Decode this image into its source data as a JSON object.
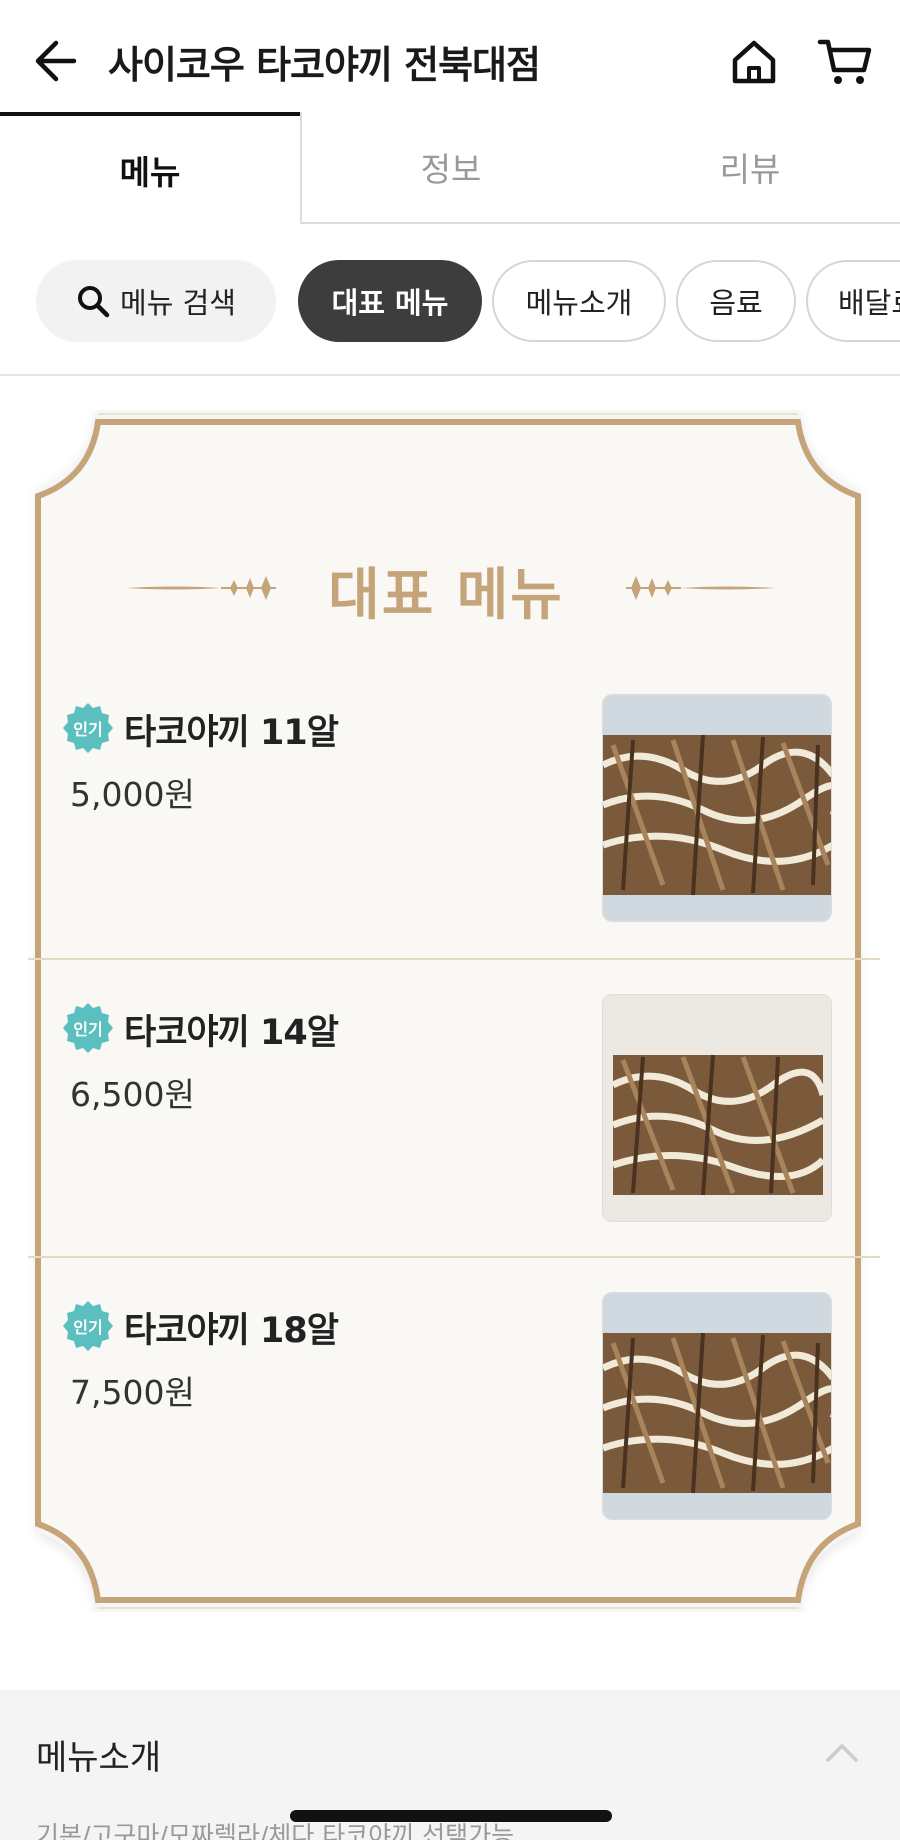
{
  "header": {
    "title": "사이코우 타코야끼 전북대점",
    "back_icon": "back-arrow-icon",
    "home_icon": "home-icon",
    "cart_icon": "cart-icon"
  },
  "tabs": [
    {
      "label": "메뉴",
      "active": true
    },
    {
      "label": "정보",
      "active": false
    },
    {
      "label": "리뷰",
      "active": false
    }
  ],
  "chips": {
    "search_label": "메뉴 검색",
    "items": [
      {
        "label": "대표 메뉴",
        "active": true
      },
      {
        "label": "메뉴소개",
        "active": false
      },
      {
        "label": "음료",
        "active": false
      },
      {
        "label": "배달료",
        "active": false
      }
    ]
  },
  "rep_menu": {
    "title": "대표 메뉴",
    "items": [
      {
        "badge": "인기",
        "name": "타코야끼 11알",
        "price": "5,000원"
      },
      {
        "badge": "인기",
        "name": "타코야끼 14알",
        "price": "6,500원"
      },
      {
        "badge": "인기",
        "name": "타코야끼 18알",
        "price": "7,500원"
      }
    ]
  },
  "intro_section": {
    "title": "메뉴소개",
    "description": "기본/고구마/모짜렐라/체다 타코야끼 선택가능"
  },
  "colors": {
    "accent_gold": "#c6a47a",
    "badge_teal": "#5bbfbf",
    "chip_active": "#3d3d3d"
  }
}
